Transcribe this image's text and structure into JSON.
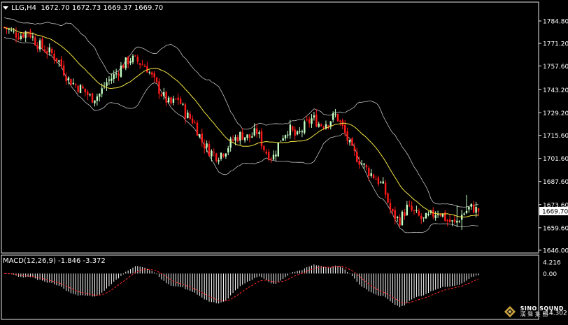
{
  "header": {
    "symbol": "LLG,H4",
    "ohlc": "1672.70 1672.73 1669.37 1669.70"
  },
  "macd": {
    "label": "MACD(12,26,9) -1.846 -3.372",
    "axis_labels": [
      "4.216",
      "0.00",
      "-14.302"
    ]
  },
  "brand": {
    "name": "SINO SOUND",
    "cn": "漢 聲 集 團"
  },
  "chart_data": {
    "type": "candlestick",
    "timeframe": "H4",
    "price_axis": {
      "ticks": [
        "1784.80",
        "1771.20",
        "1757.60",
        "1743.20",
        "1729.20",
        "1715.60",
        "1701.60",
        "1687.60",
        "1673.60",
        "1659.60",
        "1646.00"
      ],
      "ylim": [
        1643,
        1792
      ],
      "current_price": "1669.70"
    },
    "close_path": [
      1781,
      1778,
      1776,
      1779,
      1772,
      1768,
      1765,
      1760,
      1750,
      1746,
      1743,
      1738,
      1740,
      1748,
      1752,
      1758,
      1762,
      1760,
      1757,
      1748,
      1740,
      1734,
      1738,
      1728,
      1724,
      1712,
      1706,
      1703,
      1707,
      1713,
      1716,
      1714,
      1718,
      1706,
      1702,
      1714,
      1720,
      1714,
      1721,
      1726,
      1722,
      1724,
      1728,
      1718,
      1706,
      1700,
      1694,
      1690,
      1684,
      1668,
      1664,
      1672,
      1668,
      1664,
      1667,
      1670,
      1664,
      1662,
      1668,
      1672,
      1670
    ],
    "colors": {
      "up": "#c4ffc4",
      "down": "#ff1a1a",
      "ma": "#f5e642",
      "bands": "#bfbfbf",
      "macd_hist": "#ffffff",
      "macd_signal": "#ff2a2a"
    }
  }
}
